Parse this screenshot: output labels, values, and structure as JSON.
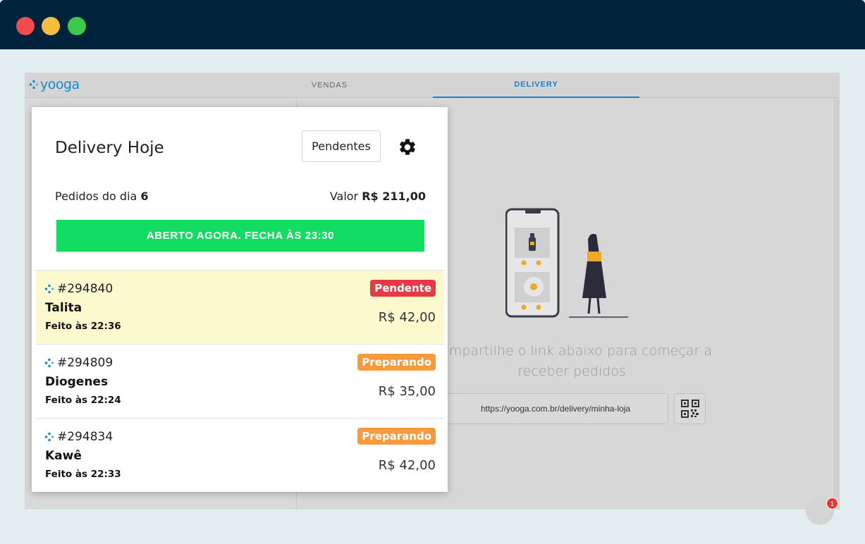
{
  "window": {
    "controls": [
      "close",
      "minimize",
      "maximize"
    ]
  },
  "app": {
    "logo_text": "yooga",
    "nav": {
      "vendas": "VENDAS",
      "delivery": "DELIVERY",
      "active": "DELIVERY"
    }
  },
  "empty_state": {
    "message": "Compartilhe o link abaixo para começar a receber pedidos",
    "link": "https://yooga.com.br/delivery/minha-loja",
    "qr_icon": "qr-code-icon"
  },
  "chat": {
    "badge_count": "1"
  },
  "panel": {
    "title": "Delivery Hoje",
    "filter_button": "Pendentes",
    "settings_icon": "gear-icon",
    "orders_label": "Pedidos do dia",
    "orders_count": "6",
    "value_label": "Valor",
    "value_amount": "R$ 211,00",
    "status_banner": "ABERTO AGORA. FECHA ÀS 23:30",
    "status_color": "#13dc62"
  },
  "orders": [
    {
      "id": "#294840",
      "name": "Talita",
      "time": "Feito às 22:36",
      "status": "Pendente",
      "status_color": "#e63946",
      "price": "R$ 42,00",
      "highlighted": true
    },
    {
      "id": "#294809",
      "name": "Diogenes",
      "time": "Feito às 22:24",
      "status": "Preparando",
      "status_color": "#f79a3e",
      "price": "R$ 35,00",
      "highlighted": false
    },
    {
      "id": "#294834",
      "name": "Kawê",
      "time": "Feito às 22:33",
      "status": "Preparando",
      "status_color": "#f79a3e",
      "price": "R$ 42,00",
      "highlighted": false
    }
  ]
}
